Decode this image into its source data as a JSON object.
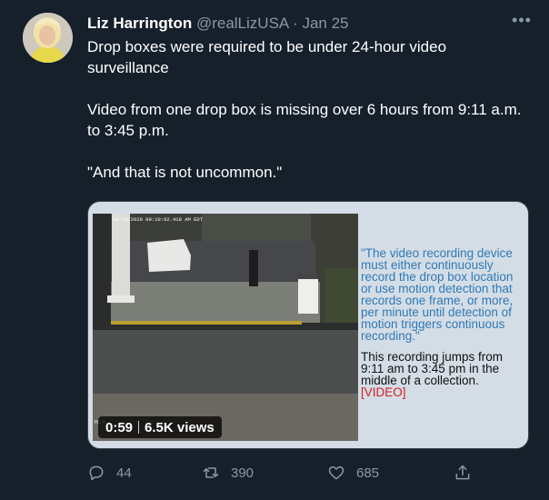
{
  "tweet": {
    "author_name": "Liz Harrington",
    "handle": "@realLizUSA",
    "separator": "·",
    "date": "Jan 25",
    "more_label": "•••",
    "text_line1": "Drop boxes were required to be under 24-hour video surveillance",
    "text_line2": "Video from one drop box is missing over 6 hours from 9:11 a.m. to 3:45 p.m.",
    "text_line3": "\"And that is not uncommon.\""
  },
  "media": {
    "timestamp_overlay": "10/29/2020 09:10:02.418 AM EDT",
    "camera_label": "HC 4",
    "duration": "0:59",
    "views": "6.5K views",
    "caption_quote": "\"The video recording device must either continuously record the drop box location or use motion detection that records one frame, or more, per minute until detection of motion triggers continuous recording.\"",
    "caption_jump": "This recording jumps from 9:11 am to 3:45 pm in the middle of a collection. ",
    "caption_link": "[VIDEO]"
  },
  "actions": {
    "replies": "44",
    "retweets": "390",
    "likes": "685"
  },
  "colors": {
    "background": "#15202b",
    "secondary_text": "#8899a6",
    "caption_blue": "#2f79b7",
    "caption_red": "#d32020"
  }
}
